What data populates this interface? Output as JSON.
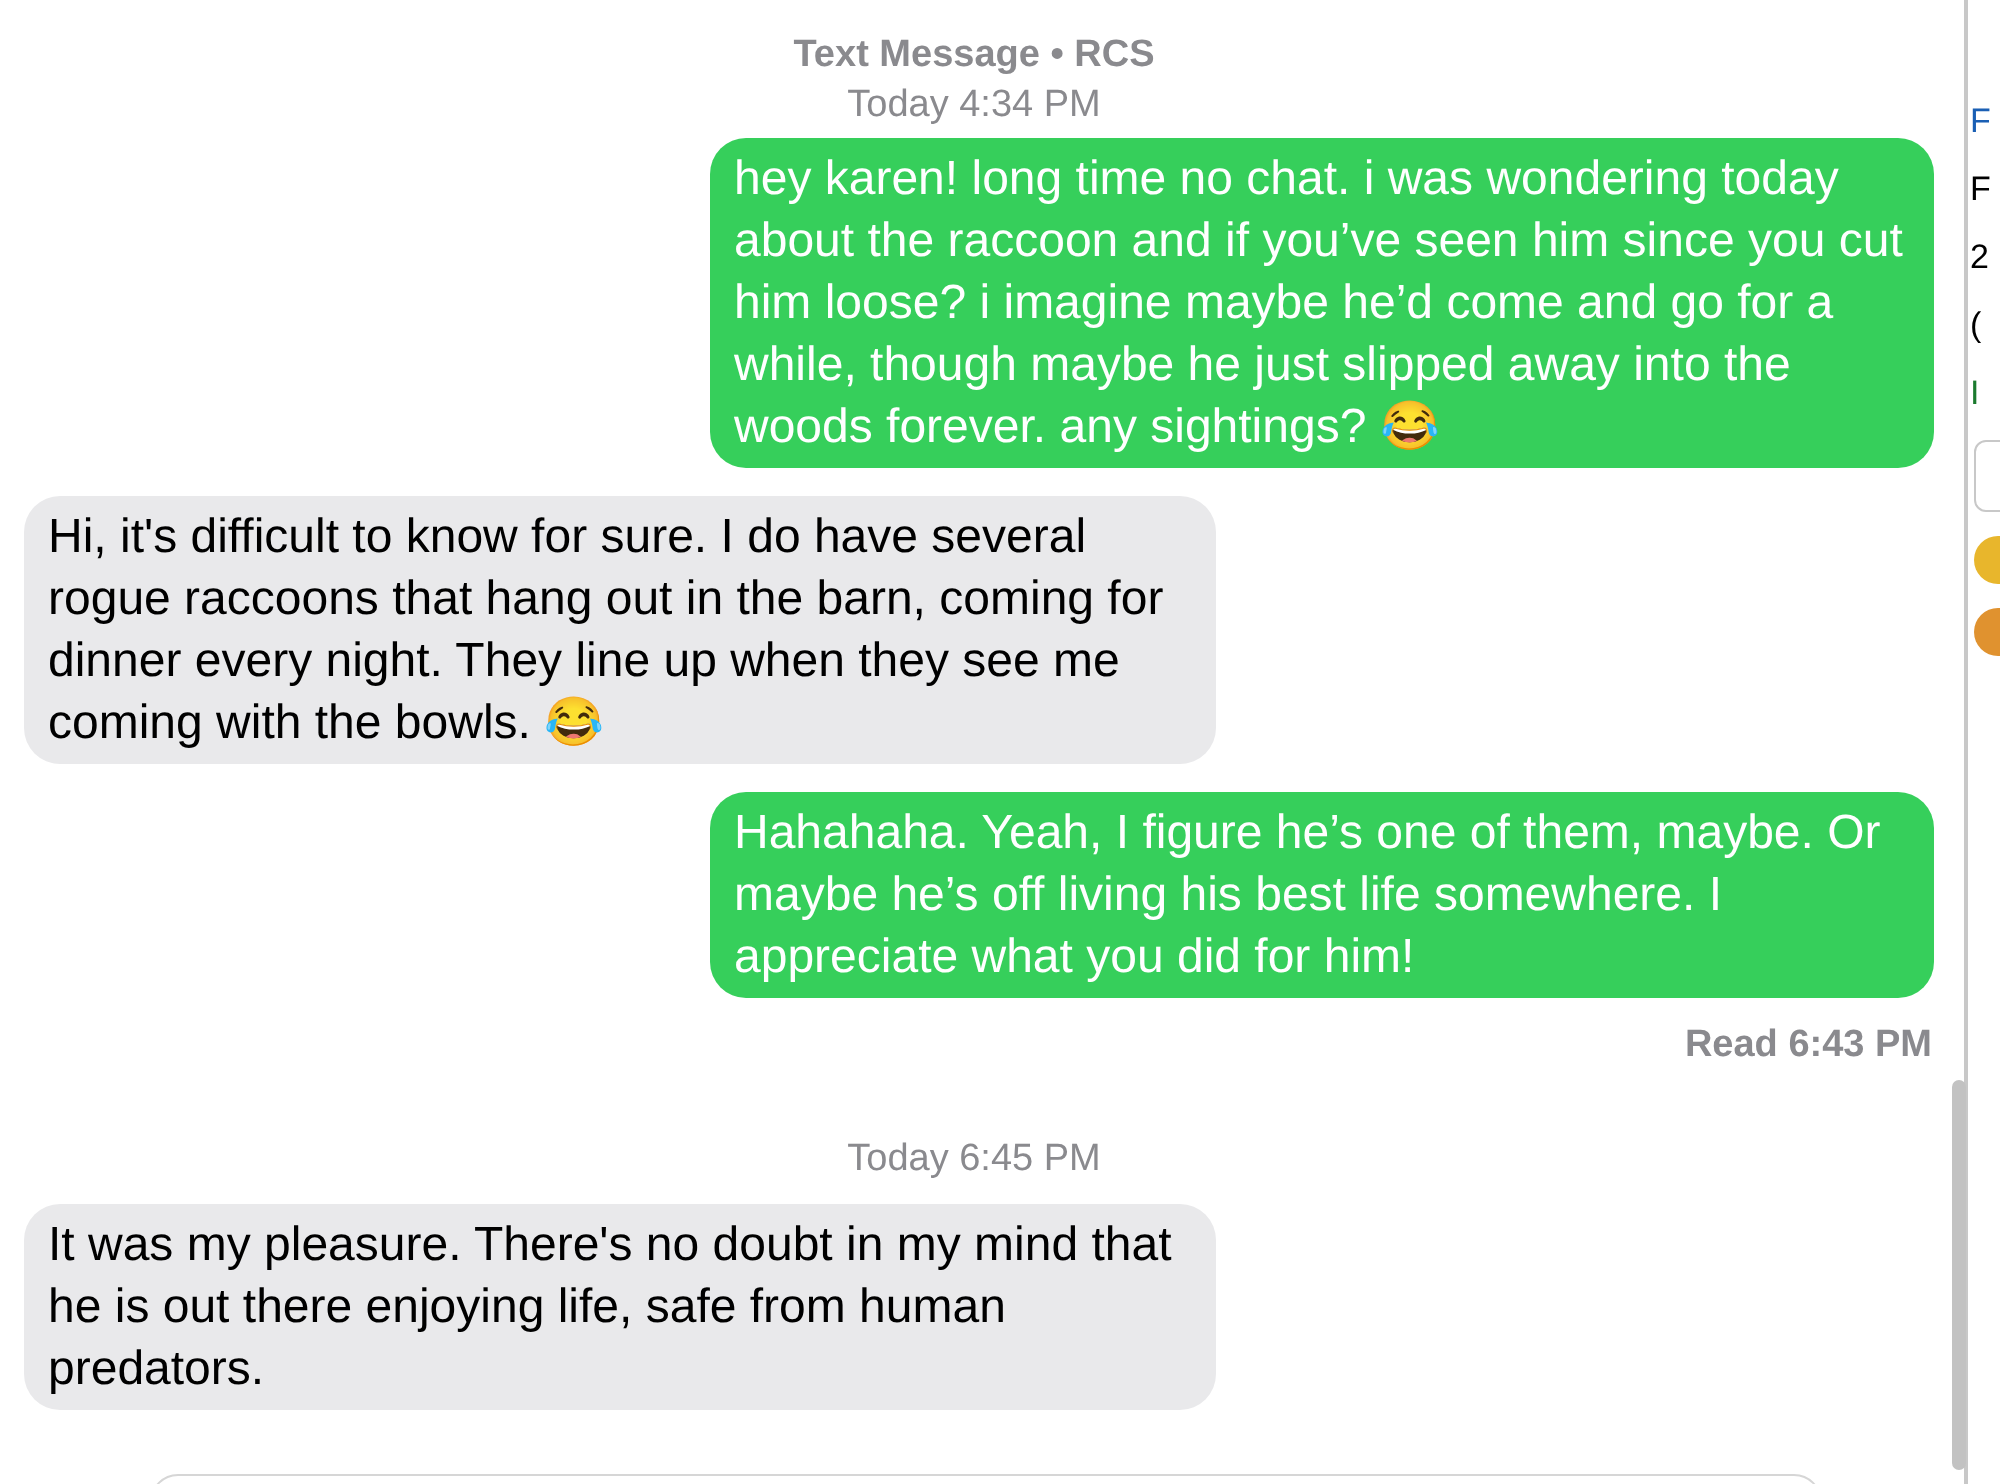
{
  "header": {
    "service": "Text Message • RCS",
    "time": "Today 4:34 PM"
  },
  "messages": [
    {
      "kind": "sent",
      "text": "hey karen! long time no chat. i was wondering today about the raccoon and if you’ve seen him since you cut him loose? i imagine maybe he’d come and go for a while, though maybe he just slipped away into the woods forever. any sightings? 😂"
    },
    {
      "kind": "received",
      "text": "Hi, it's difficult to know for sure. I do have several rogue raccoons that hang out in the barn, coming for dinner every night.  They line up when they see me coming with the bowls.  😂"
    },
    {
      "kind": "sent",
      "text": "Hahahaha. Yeah, I figure he’s one of them, maybe. Or maybe he’s off living his best life somewhere. I appreciate what you did for him!"
    },
    {
      "kind": "receipt",
      "text": "Read 6:43 PM"
    },
    {
      "kind": "timestamp",
      "text": "Today 6:45 PM"
    },
    {
      "kind": "received",
      "text": "It was my pleasure.  There's no doubt in my mind that he is out there enjoying life,  safe from human predators."
    }
  ],
  "side_panel": [
    {
      "kind": "link",
      "text": "F"
    },
    {
      "kind": "text",
      "text": "F"
    },
    {
      "kind": "text",
      "text": "2"
    },
    {
      "kind": "text",
      "text": "("
    },
    {
      "kind": "accent",
      "text": "I"
    }
  ]
}
